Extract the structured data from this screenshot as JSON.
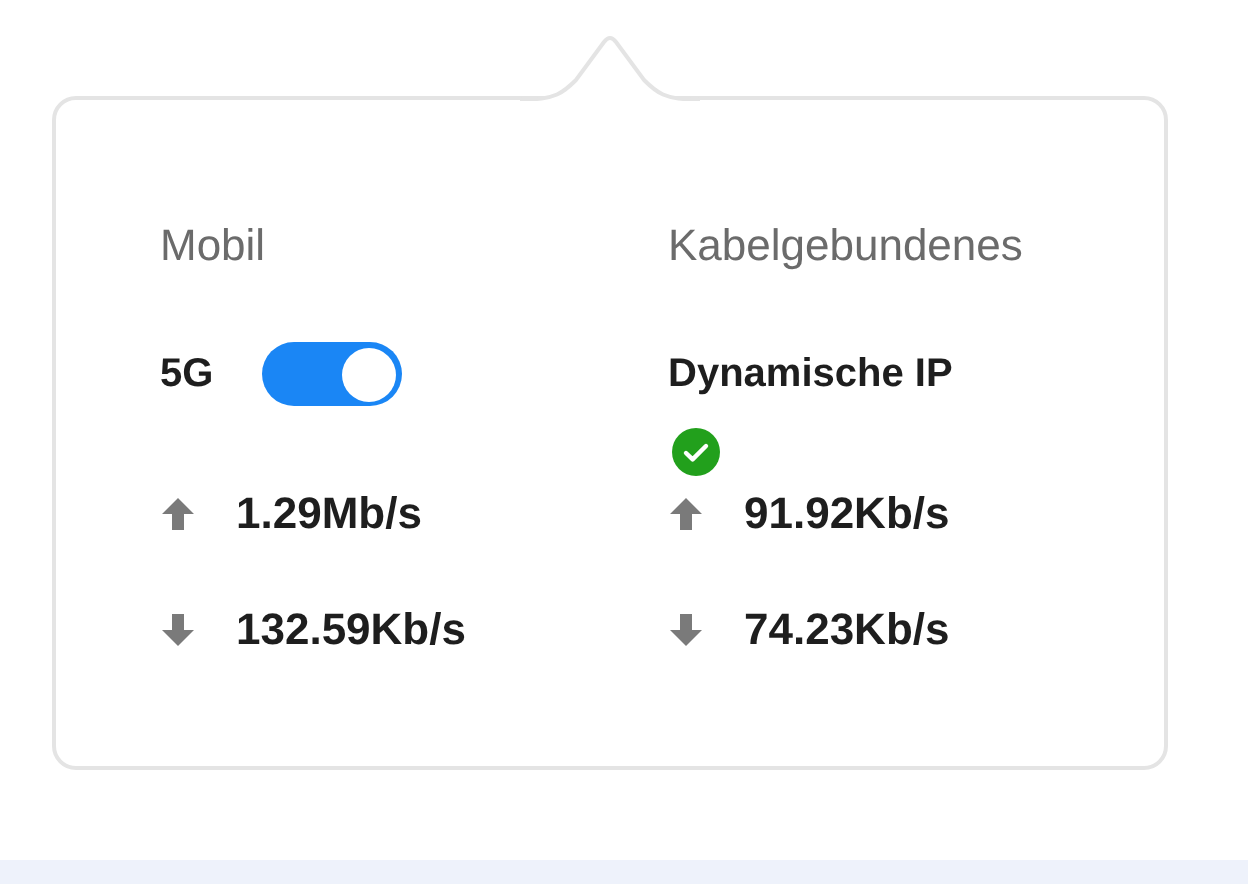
{
  "columns": [
    {
      "kind": "mobile",
      "title": "Mobil",
      "network": "5G",
      "toggle_on": true,
      "upload": "1.29Mb/s",
      "download": "132.59Kb/s"
    },
    {
      "kind": "wired",
      "title": "Kabelgebundenes",
      "mode": "Dynamische IP",
      "connected": true,
      "upload": "91.92Kb/s",
      "download": "74.23Kb/s"
    }
  ]
}
